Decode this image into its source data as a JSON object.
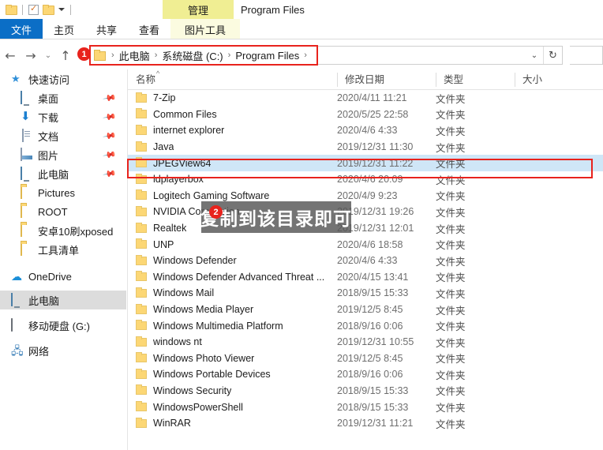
{
  "window": {
    "title": "Program Files",
    "contextual_tab": "管理"
  },
  "quick_access_toolbar": {
    "items": [
      {
        "name": "folder-icon",
        "label": ""
      },
      {
        "name": "properties-icon",
        "label": ""
      },
      {
        "name": "new-folder-icon",
        "label": ""
      },
      {
        "name": "customize-dropdown-icon",
        "label": ""
      }
    ]
  },
  "ribbon": {
    "tabs": [
      {
        "label": "文件",
        "active": true
      },
      {
        "label": "主页",
        "active": false
      },
      {
        "label": "共享",
        "active": false
      },
      {
        "label": "查看",
        "active": false
      },
      {
        "label": "图片工具",
        "active": false
      }
    ]
  },
  "navigation": {
    "back_icon": "←",
    "forward_icon": "→",
    "recent_icon": "⌄",
    "up_icon": "↑",
    "refresh_icon": "↻",
    "dropdown_icon": "⌄",
    "breadcrumb": [
      "此电脑",
      "系统磁盘 (C:)",
      "Program Files"
    ],
    "separator": "›"
  },
  "search": {
    "placeholder": ""
  },
  "sidebar": {
    "items": [
      {
        "label": "快速访问",
        "icon": "star-icon",
        "pinned": false,
        "selected": false,
        "indent": 0
      },
      {
        "label": "桌面",
        "icon": "desktop-icon",
        "pinned": true,
        "selected": false,
        "indent": 1
      },
      {
        "label": "下载",
        "icon": "download-icon",
        "pinned": true,
        "selected": false,
        "indent": 1
      },
      {
        "label": "文档",
        "icon": "documents-icon",
        "pinned": true,
        "selected": false,
        "indent": 1
      },
      {
        "label": "图片",
        "icon": "pictures-icon",
        "pinned": true,
        "selected": false,
        "indent": 1
      },
      {
        "label": "此电脑",
        "icon": "this-pc-icon",
        "pinned": true,
        "selected": false,
        "indent": 1
      },
      {
        "label": "Pictures",
        "icon": "folder-icon",
        "pinned": false,
        "selected": false,
        "indent": 1
      },
      {
        "label": "ROOT",
        "icon": "folder-icon",
        "pinned": false,
        "selected": false,
        "indent": 1
      },
      {
        "label": "安卓10刷xposed",
        "icon": "folder-icon",
        "pinned": false,
        "selected": false,
        "indent": 1
      },
      {
        "label": "工具清单",
        "icon": "folder-icon",
        "pinned": false,
        "selected": false,
        "indent": 1
      },
      {
        "label": "OneDrive",
        "icon": "cloud-icon",
        "pinned": false,
        "selected": false,
        "indent": 0
      },
      {
        "label": "此电脑",
        "icon": "this-pc-icon",
        "pinned": false,
        "selected": true,
        "indent": 0
      },
      {
        "label": "移动硬盘 (G:)",
        "icon": "hard-drive-icon",
        "pinned": false,
        "selected": false,
        "indent": 0
      },
      {
        "label": "网络",
        "icon": "network-icon",
        "pinned": false,
        "selected": false,
        "indent": 0
      }
    ]
  },
  "file_list": {
    "columns": [
      {
        "label": "名称",
        "key": "name"
      },
      {
        "label": "修改日期",
        "key": "date"
      },
      {
        "label": "类型",
        "key": "type"
      },
      {
        "label": "大小",
        "key": "size"
      }
    ],
    "sort_indicator": "^",
    "rows": [
      {
        "name": "7-Zip",
        "date": "2020/4/11 11:21",
        "type": "文件夹",
        "size": "",
        "selected": false
      },
      {
        "name": "Common Files",
        "date": "2020/5/25 22:58",
        "type": "文件夹",
        "size": "",
        "selected": false
      },
      {
        "name": "internet explorer",
        "date": "2020/4/6 4:33",
        "type": "文件夹",
        "size": "",
        "selected": false
      },
      {
        "name": "Java",
        "date": "2019/12/31 11:30",
        "type": "文件夹",
        "size": "",
        "selected": false
      },
      {
        "name": "JPEGView64",
        "date": "2019/12/31 11:22",
        "type": "文件夹",
        "size": "",
        "selected": true
      },
      {
        "name": "ldplayerbox",
        "date": "2020/4/6 20:09",
        "type": "文件夹",
        "size": "",
        "selected": false
      },
      {
        "name": "Logitech Gaming Software",
        "date": "2020/4/9 9:23",
        "type": "文件夹",
        "size": "",
        "selected": false
      },
      {
        "name": "NVIDIA Corporation",
        "date": "2019/12/31 19:26",
        "type": "文件夹",
        "size": "",
        "selected": false
      },
      {
        "name": "Realtek",
        "date": "2019/12/31 12:01",
        "type": "文件夹",
        "size": "",
        "selected": false
      },
      {
        "name": "UNP",
        "date": "2020/4/6 18:58",
        "type": "文件夹",
        "size": "",
        "selected": false
      },
      {
        "name": "Windows Defender",
        "date": "2020/4/6 4:33",
        "type": "文件夹",
        "size": "",
        "selected": false
      },
      {
        "name": "Windows Defender Advanced Threat ...",
        "date": "2020/4/15 13:41",
        "type": "文件夹",
        "size": "",
        "selected": false
      },
      {
        "name": "Windows Mail",
        "date": "2018/9/15 15:33",
        "type": "文件夹",
        "size": "",
        "selected": false
      },
      {
        "name": "Windows Media Player",
        "date": "2019/12/5 8:45",
        "type": "文件夹",
        "size": "",
        "selected": false
      },
      {
        "name": "Windows Multimedia Platform",
        "date": "2018/9/16 0:06",
        "type": "文件夹",
        "size": "",
        "selected": false
      },
      {
        "name": "windows nt",
        "date": "2019/12/31 10:55",
        "type": "文件夹",
        "size": "",
        "selected": false
      },
      {
        "name": "Windows Photo Viewer",
        "date": "2019/12/5 8:45",
        "type": "文件夹",
        "size": "",
        "selected": false
      },
      {
        "name": "Windows Portable Devices",
        "date": "2018/9/16 0:06",
        "type": "文件夹",
        "size": "",
        "selected": false
      },
      {
        "name": "Windows Security",
        "date": "2018/9/15 15:33",
        "type": "文件夹",
        "size": "",
        "selected": false
      },
      {
        "name": "WindowsPowerShell",
        "date": "2018/9/15 15:33",
        "type": "文件夹",
        "size": "",
        "selected": false
      },
      {
        "name": "WinRAR",
        "date": "2019/12/31 11:21",
        "type": "文件夹",
        "size": "",
        "selected": false
      }
    ]
  },
  "annotations": {
    "badge_1": "1",
    "badge_2": "2",
    "callout_text": "复制到该目录即可",
    "highlight_color": "#e8231d"
  }
}
